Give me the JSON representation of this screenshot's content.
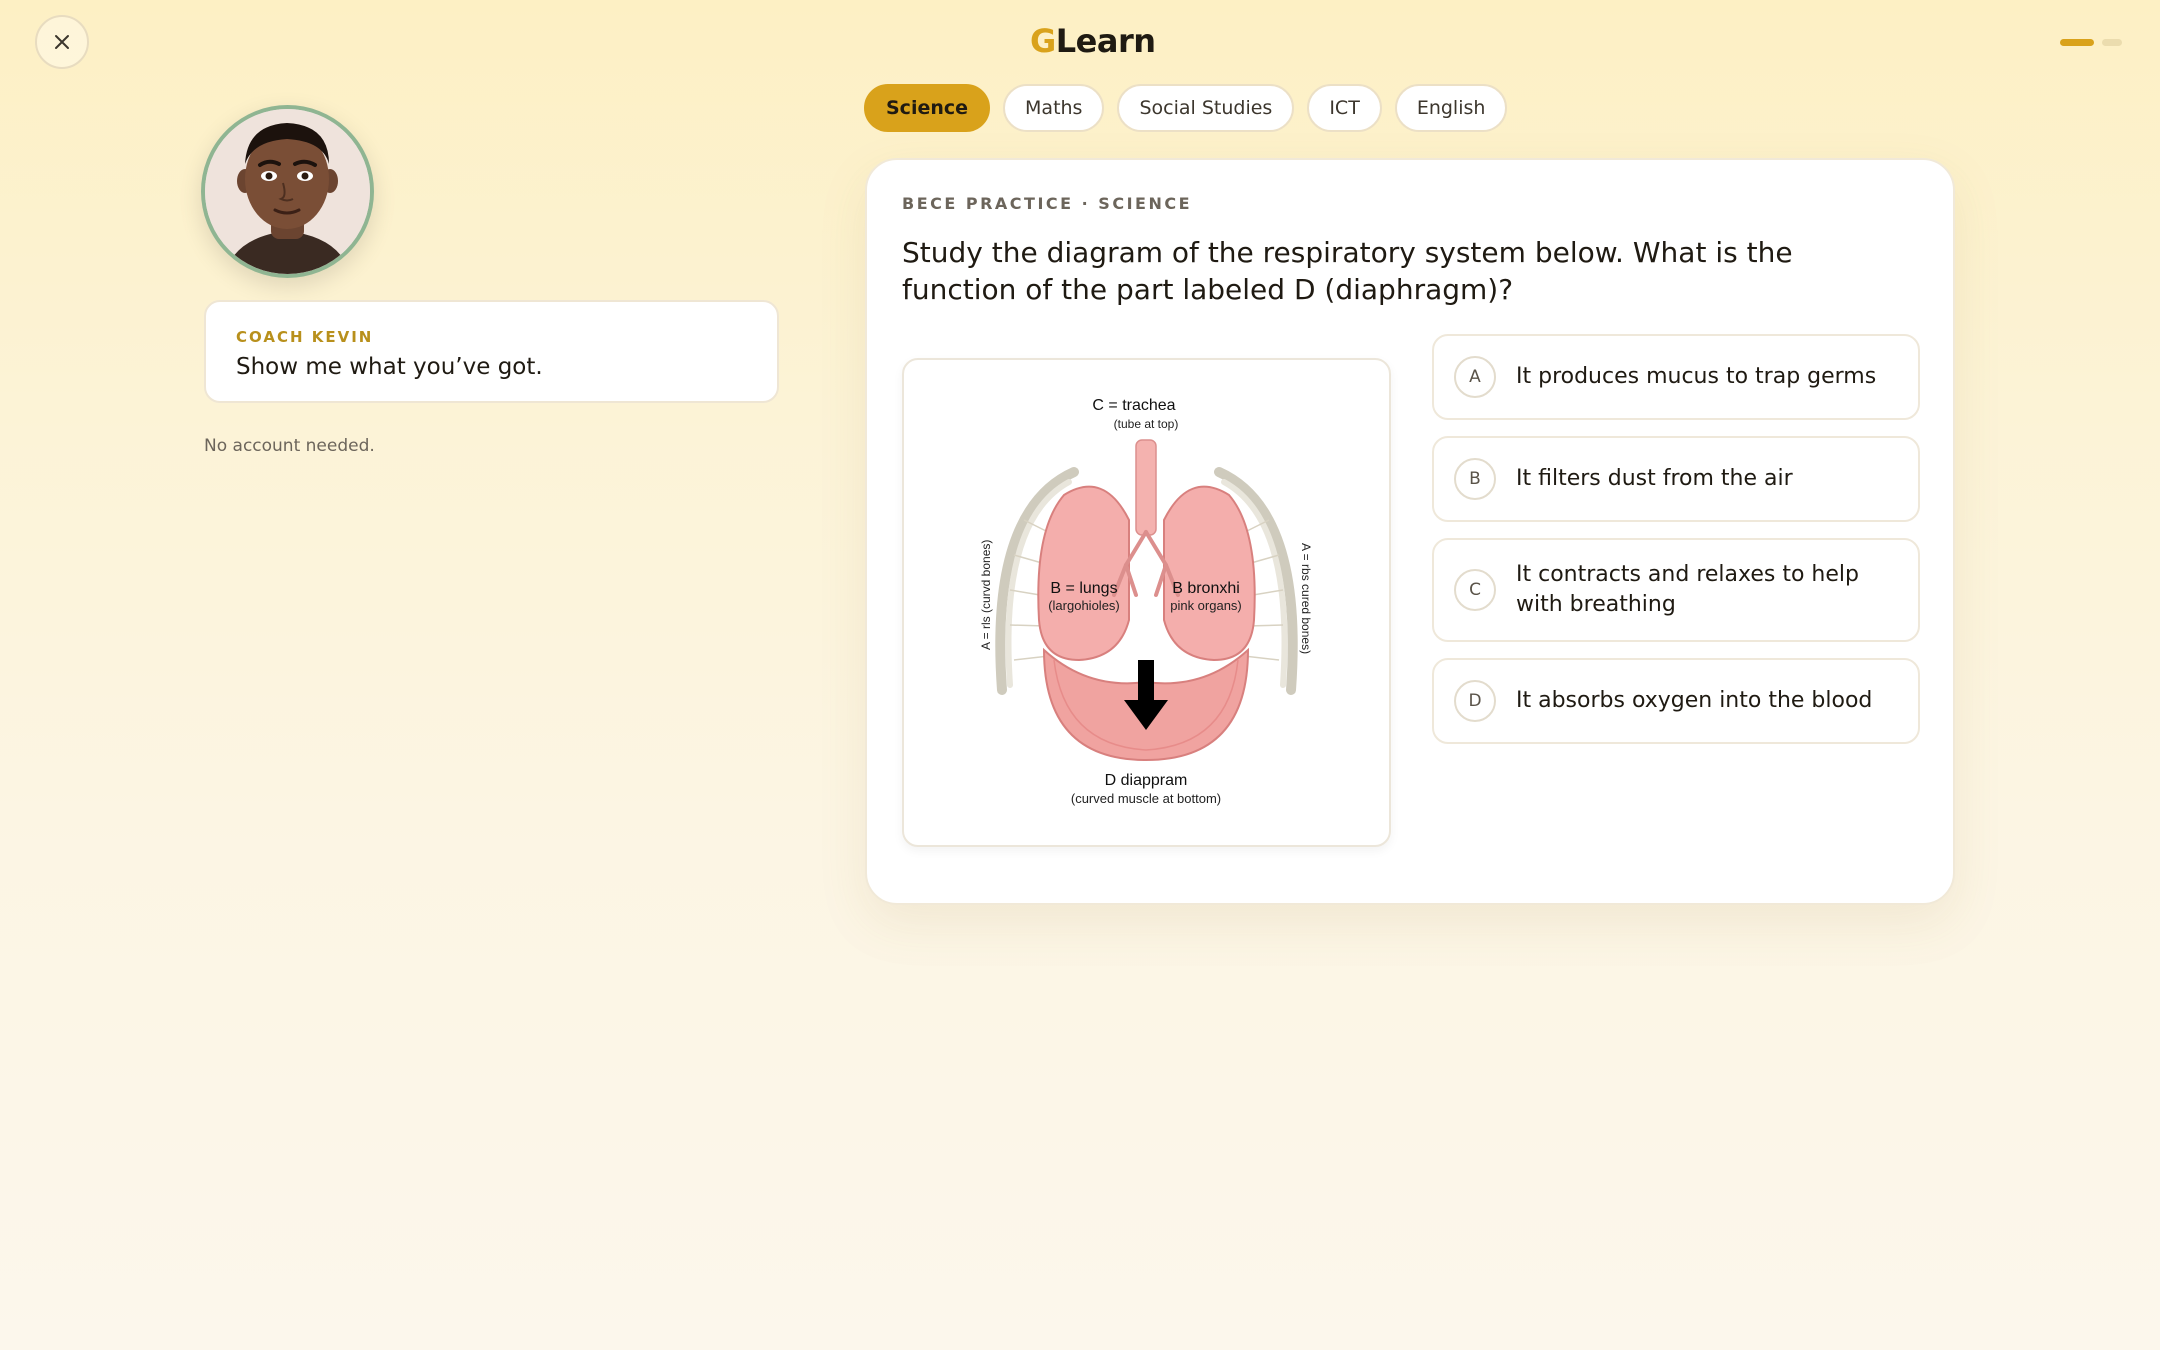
{
  "header": {
    "logo_first": "G",
    "logo_rest": "Learn",
    "progress": {
      "current": 1,
      "total": 2
    }
  },
  "coach": {
    "name": "COACH KEVIN",
    "message": "Show me what you’ve got.",
    "note": "No account needed."
  },
  "tabs": [
    {
      "label": "Science",
      "active": true
    },
    {
      "label": "Maths",
      "active": false
    },
    {
      "label": "Social Studies",
      "active": false
    },
    {
      "label": "ICT",
      "active": false
    },
    {
      "label": "English",
      "active": false
    }
  ],
  "question": {
    "label": "BECE PRACTICE · SCIENCE",
    "text": "Study the diagram of the respiratory system below. What is the function of the part labeled D (diaphragm)?",
    "diagram": {
      "trachea_label": "C = trachea",
      "trachea_sub": "(tube at top)",
      "lungs_label": "B = lungs",
      "lungs_sub": "(largohioles)",
      "bronchi_label": "B bronxhi",
      "bronchi_sub": "pink organs)",
      "ribs_left": "A = rls (curvd bones)",
      "ribs_right": "A = rbs cured bones)",
      "diaphragm_label": "D diappram",
      "diaphragm_sub": "(curved muscle at bottom)"
    },
    "options": [
      {
        "letter": "A",
        "text": "It produces mucus to trap germs"
      },
      {
        "letter": "B",
        "text": "It filters dust from the air"
      },
      {
        "letter": "C",
        "text": "It contracts and relaxes to help with breathing"
      },
      {
        "letter": "D",
        "text": "It absorbs oxygen into the blood"
      }
    ]
  },
  "colors": {
    "accent": "#d9a21b",
    "coach_name": "#b8901c",
    "avatar_ring": "#8fb592"
  }
}
